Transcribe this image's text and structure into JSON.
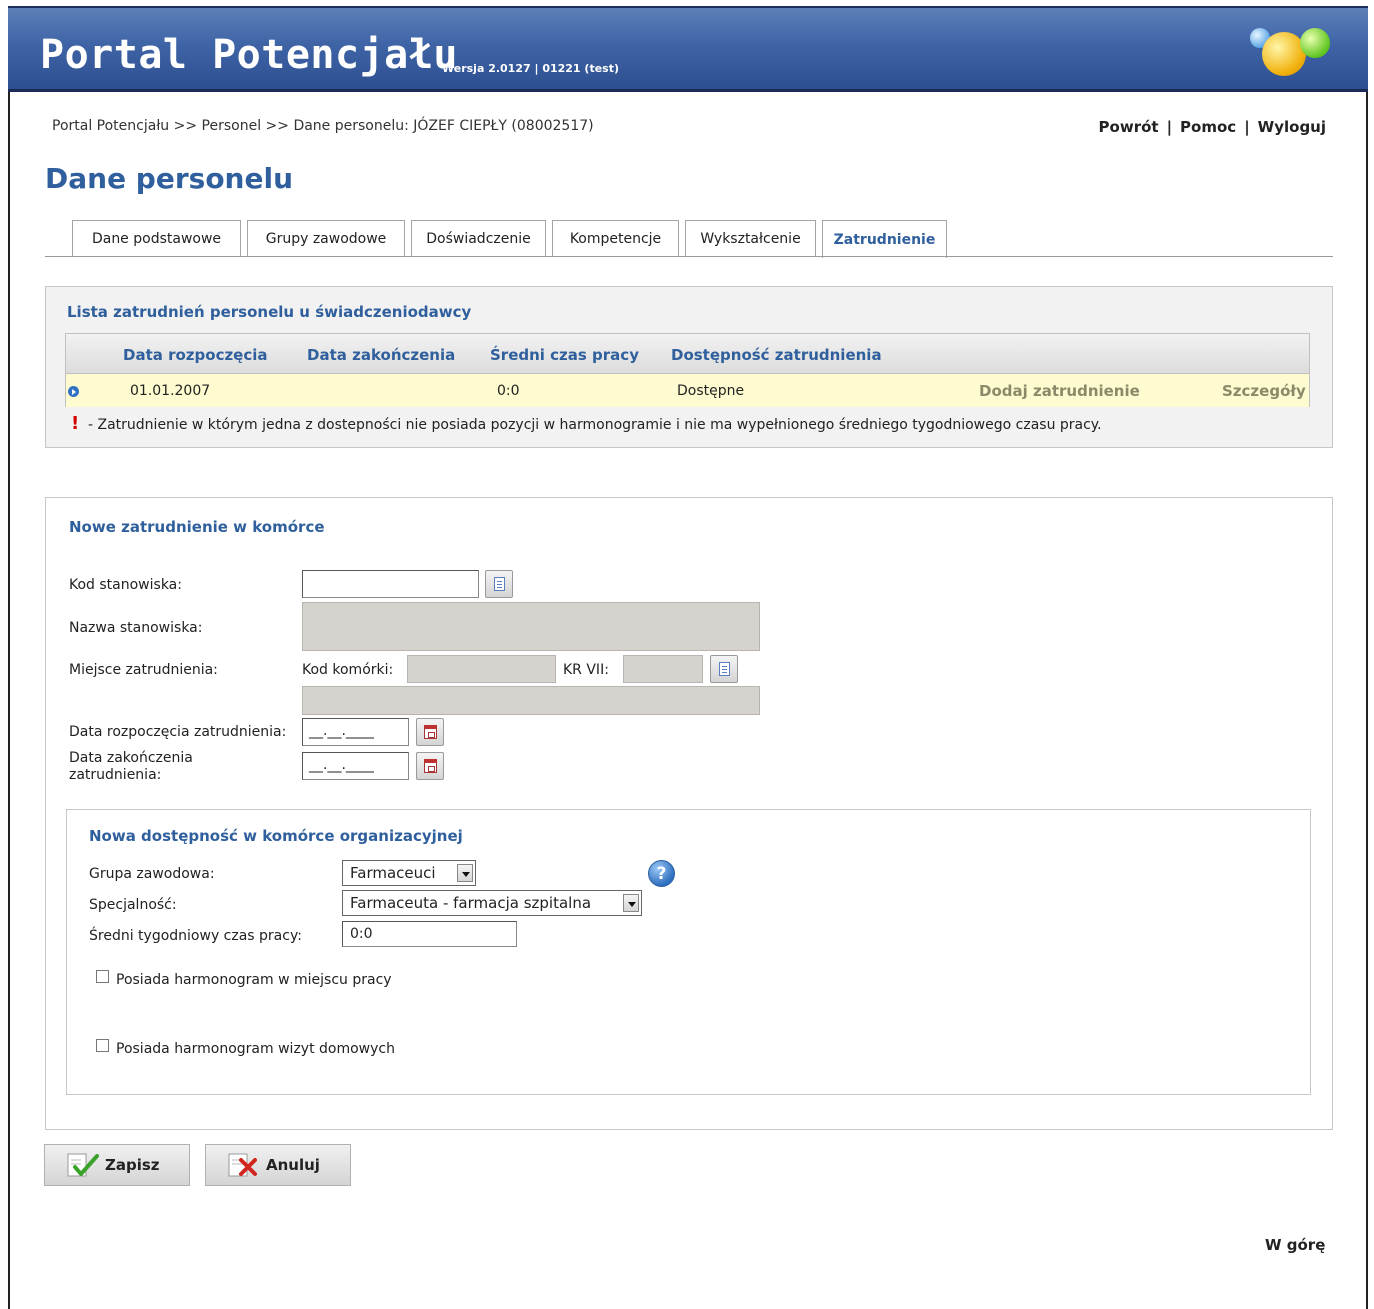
{
  "app": {
    "title": "Portal Potencjału",
    "version": "Wersja 2.0127 | 01221 (test)"
  },
  "breadcrumb": "Portal Potencjału >> Personel >> Dane personelu: JÓZEF CIEPŁY (08002517)",
  "top_links": {
    "back": "Powrót",
    "help": "Pomoc",
    "logout": "Wyloguj",
    "separator": "|"
  },
  "page_title": "Dane personelu",
  "tabs": [
    {
      "label": "Dane podstawowe",
      "active": false
    },
    {
      "label": "Grupy zawodowe",
      "active": false
    },
    {
      "label": "Doświadczenie",
      "active": false
    },
    {
      "label": "Kompetencje",
      "active": false
    },
    {
      "label": "Wykształcenie",
      "active": false
    },
    {
      "label": "Zatrudnienie",
      "active": true
    }
  ],
  "employment_list": {
    "title": "Lista zatrudnień personelu u świadczeniodawcy",
    "columns": [
      "Data rozpoczęcia",
      "Data zakończenia",
      "Średni czas pracy",
      "Dostępność zatrudnienia"
    ],
    "rows": [
      {
        "start": "01.01.2007",
        "end": "",
        "avg_time": "0:0",
        "availability": "Dostępne",
        "add_link": "Dodaj zatrudnienie",
        "details_link": "Szczegóły"
      }
    ],
    "warning_mark": "!",
    "warning_text": "- Zatrudnienie w którym jedna z dostepności nie posiada pozycji w harmonogramie i nie ma wypełnionego średniego tygodniowego czasu pracy."
  },
  "new_employment": {
    "title": "Nowe zatrudnienie w komórce",
    "position_code_label": "Kod stanowiska:",
    "position_code_value": "",
    "position_name_label": "Nazwa stanowiska:",
    "workplace_label": "Miejsce zatrudnienia:",
    "unit_code_label": "Kod komórki:",
    "kr_label": "KR VII:",
    "start_date_label": "Data rozpoczęcia zatrudnienia:",
    "start_date_value": "__.__.____",
    "end_date_label": "Data zakończenia zatrudnienia:",
    "end_date_value": "__.__.____"
  },
  "new_availability": {
    "title": "Nowa dostępność w komórce organizacyjnej",
    "group_label": "Grupa zawodowa:",
    "group_value": "Farmaceuci",
    "specialty_label": "Specjalność:",
    "specialty_value": "Farmaceuta - farmacja szpitalna",
    "avg_time_label": "Średni tygodniowy czas pracy:",
    "avg_time_value": "0:0",
    "schedule_workplace_label": "Posiada harmonogram w miejscu pracy",
    "schedule_workplace_checked": false,
    "schedule_home_label": "Posiada harmonogram wizyt domowych",
    "schedule_home_checked": false,
    "help_glyph": "?"
  },
  "buttons": {
    "save": "Zapisz",
    "cancel": "Anuluj"
  },
  "footer": {
    "top_link": "W górę"
  },
  "colors": {
    "header_blue": "#3f64a6",
    "accent_text": "#2f5f9c",
    "row_highlight": "#fdfbcf",
    "warning": "#d40000"
  },
  "icons": {
    "row_marker": "arrow-circle-icon",
    "picker": "list-icon",
    "calendar": "calendar-icon",
    "help": "help-icon",
    "save": "checkmark-icon",
    "cancel": "x-icon"
  }
}
